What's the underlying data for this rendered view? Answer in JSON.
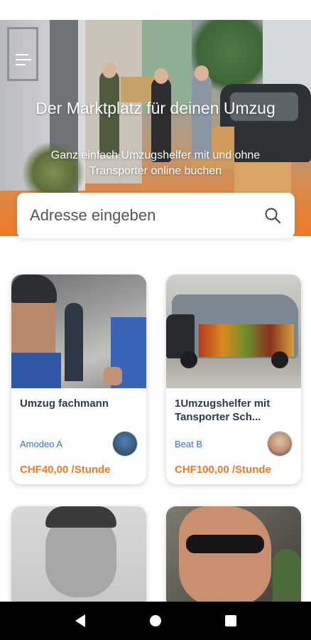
{
  "hero": {
    "title": "Der Marktplatz für deinen Umzug",
    "subtitle": "Ganz einfach Umzugshelfer mit und ohne Transporter online buchen"
  },
  "search": {
    "placeholder": "Adresse eingeben",
    "value": "",
    "icon": "search-icon"
  },
  "listings": [
    {
      "title": "Umzug fachmann",
      "author": "Amodeo A",
      "price": "CHF40,00 /Stunde"
    },
    {
      "title": "1Umzugshelfer mit Tansporter Sch...",
      "author": "Beat  B",
      "price": "CHF100,00 /Stunde"
    }
  ],
  "navigation": {
    "back_icon": "back-triangle-icon",
    "home_icon": "home-circle-icon",
    "recents_icon": "recents-square-icon"
  },
  "colors": {
    "accent": "#ef7b22",
    "author_link": "#3b6fbf",
    "card_title": "#2c3a4a"
  }
}
